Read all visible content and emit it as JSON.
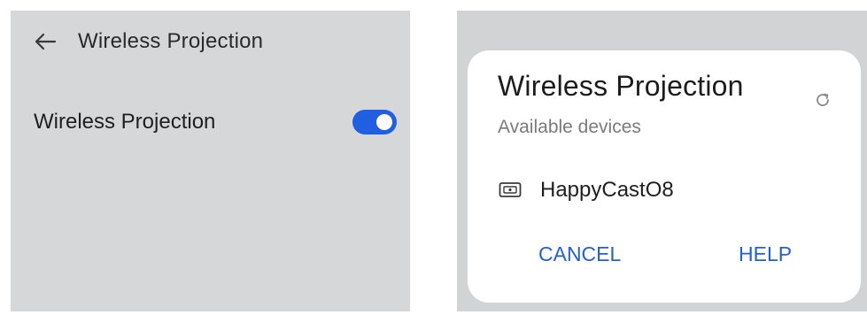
{
  "left_screen": {
    "header": {
      "back_icon": "arrow-left-icon",
      "title": "Wireless Projection"
    },
    "setting": {
      "label": "Wireless Projection",
      "toggle_on": true
    },
    "colors": {
      "background": "#d6d7d9",
      "toggle_accent": "#1f5fe0"
    }
  },
  "right_screen": {
    "dialog": {
      "title": "Wireless Projection",
      "subtitle": "Available devices",
      "refresh_icon": "refresh-icon",
      "devices": [
        {
          "icon": "screen-device-icon",
          "name": "HappyCastO8"
        }
      ],
      "actions": {
        "cancel_label": "CANCEL",
        "help_label": "HELP"
      }
    },
    "colors": {
      "background": "#d2d3d5",
      "dialog_bg": "#ffffff",
      "action_text": "#2360d6"
    }
  }
}
